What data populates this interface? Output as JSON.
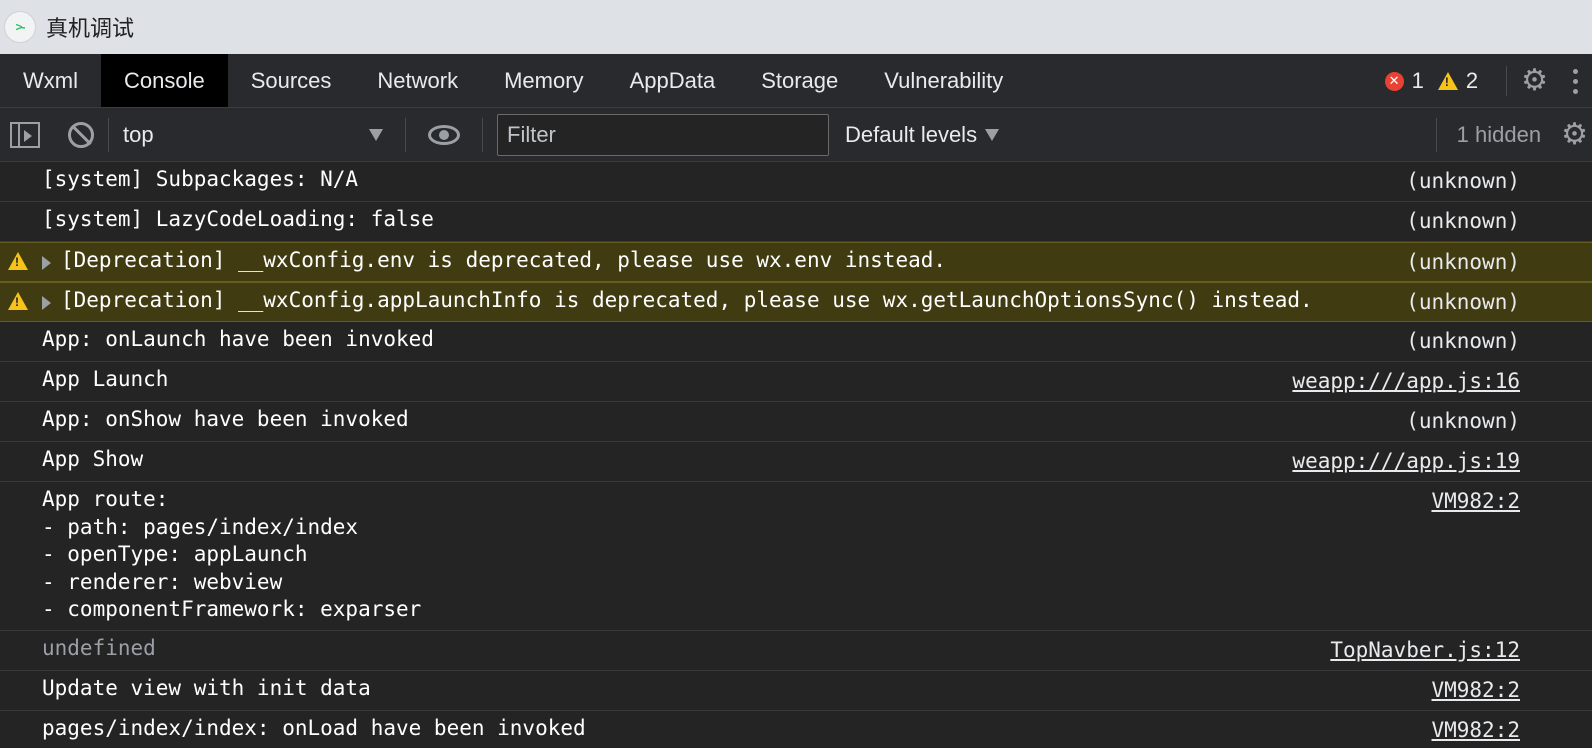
{
  "window": {
    "title": "真机调试",
    "logo_glyph": ">-"
  },
  "tabs": [
    {
      "label": "Wxml",
      "active": false
    },
    {
      "label": "Console",
      "active": true
    },
    {
      "label": "Sources",
      "active": false
    },
    {
      "label": "Network",
      "active": false
    },
    {
      "label": "Memory",
      "active": false
    },
    {
      "label": "AppData",
      "active": false
    },
    {
      "label": "Storage",
      "active": false
    },
    {
      "label": "Vulnerability",
      "active": false
    }
  ],
  "status": {
    "error_count": "1",
    "warning_count": "2",
    "error_color": "#e94235",
    "warning_color": "#f7c31b"
  },
  "toolbar": {
    "context": "top",
    "filter_placeholder": "Filter",
    "filter_value": "",
    "levels": "Default levels",
    "hidden": "1 hidden"
  },
  "messages": [
    {
      "text": "[system] Subpackages: N/A",
      "source": "(unknown)"
    },
    {
      "text": "[system] LazyCodeLoading: false",
      "source": "(unknown)"
    },
    {
      "text": "[Deprecation] __wxConfig.env is deprecated, please use wx.env instead.",
      "source": "(unknown)"
    },
    {
      "text": "[Deprecation] __wxConfig.appLaunchInfo is deprecated, please use wx.getLaunchOptionsSync() instead.",
      "source": "(unknown)"
    },
    {
      "text": "App: onLaunch have been invoked",
      "source": "(unknown)"
    },
    {
      "text": "App Launch",
      "source": "weapp:///app.js:16"
    },
    {
      "text": "App: onShow have been invoked",
      "source": "(unknown)"
    },
    {
      "text": "App Show",
      "source": "weapp:///app.js:19"
    },
    {
      "text": "App route:\n- path: pages/index/index\n- openType: appLaunch\n- renderer: webview\n- componentFramework: exparser",
      "source": "VM982:2"
    },
    {
      "text": "undefined",
      "source": "TopNavber.js:12"
    },
    {
      "text": "Update view with init data",
      "source": "VM982:2"
    },
    {
      "text": "pages/index/index: onLoad have been invoked",
      "source": "VM982:2"
    }
  ]
}
